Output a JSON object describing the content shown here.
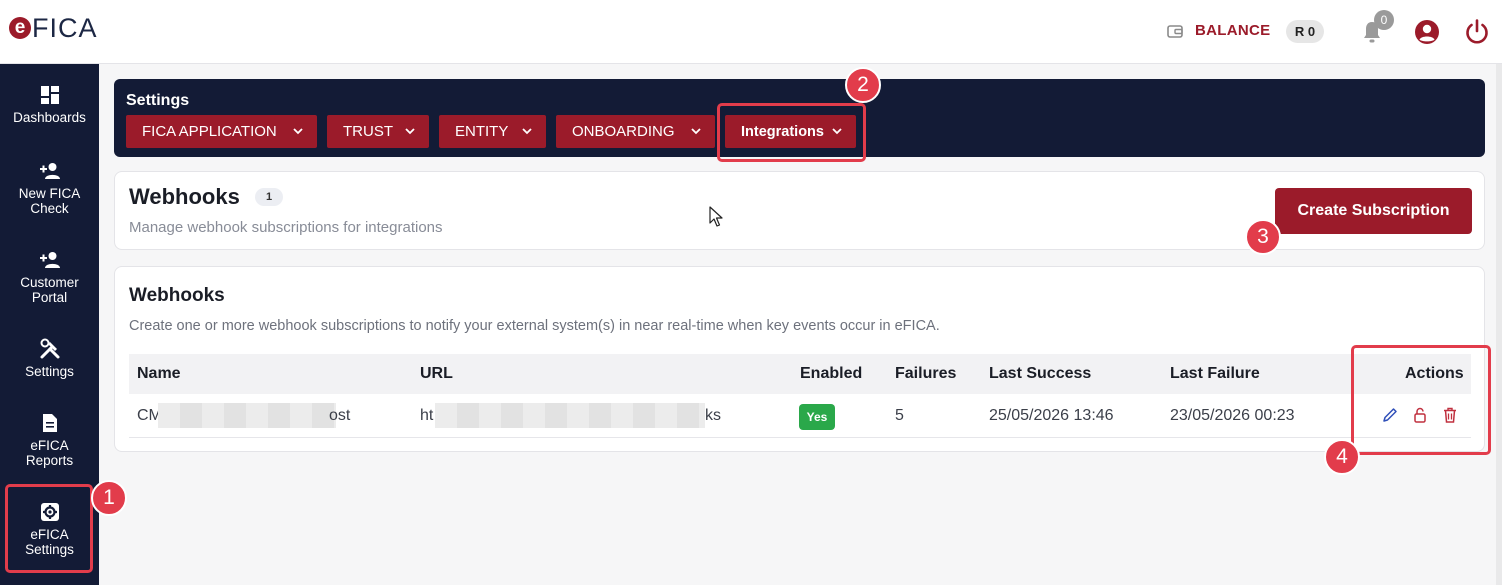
{
  "app": {
    "logo_e": "e",
    "logo_text": "FICA"
  },
  "header": {
    "balance_label": "BALANCE",
    "balance_value": "R 0",
    "notification_count": "0"
  },
  "sidebar": {
    "items": [
      {
        "label": "Dashboards",
        "icon": "dashboard-icon"
      },
      {
        "label": "New FICA\nCheck",
        "icon": "add-person-icon"
      },
      {
        "label": "Customer\nPortal",
        "icon": "add-person-icon"
      },
      {
        "label": "Settings",
        "icon": "tools-icon"
      },
      {
        "label": "eFICA\nReports",
        "icon": "report-icon"
      },
      {
        "label": "eFICA\nSettings",
        "icon": "gear-icon"
      }
    ]
  },
  "settings_bar": {
    "title": "Settings",
    "tabs": [
      {
        "label": "FICA APPLICATION"
      },
      {
        "label": "TRUST"
      },
      {
        "label": "ENTITY"
      },
      {
        "label": "ONBOARDING"
      },
      {
        "label": "Integrations"
      }
    ]
  },
  "page": {
    "title": "Webhooks",
    "count": "1",
    "subtitle": "Manage webhook subscriptions for integrations",
    "create_button": "Create Subscription"
  },
  "webhooks_card": {
    "title": "Webhooks",
    "description": "Create one or more webhook subscriptions to notify your external system(s) in near real-time when key events occur in eFICA.",
    "columns": [
      "Name",
      "URL",
      "Enabled",
      "Failures",
      "Last Success",
      "Last Failure",
      "Actions"
    ],
    "rows": [
      {
        "name_prefix": "CM",
        "name_suffix": "ost",
        "url_prefix": "ht",
        "url_suffix": "ks",
        "enabled": "Yes",
        "failures": "5",
        "last_success": "25/05/2026 13:46",
        "last_failure": "23/05/2026 00:23"
      }
    ]
  },
  "annotations": [
    "1",
    "2",
    "3",
    "4"
  ],
  "colors": {
    "brand": "#9b1b2a",
    "navy": "#131b36",
    "highlight": "#e23c4b",
    "success": "#2aa84a"
  }
}
